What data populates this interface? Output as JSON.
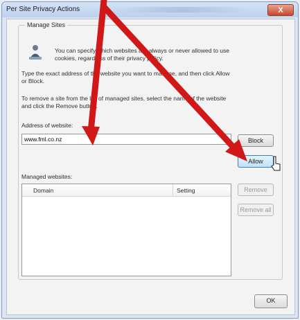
{
  "window": {
    "title": "Per Site Privacy Actions",
    "close_label": "X"
  },
  "group": {
    "label": "Manage Sites"
  },
  "info": {
    "line1": "You can specify which websites are always or never allowed to use",
    "line2": "cookies, regardless of their privacy policy."
  },
  "instructions": {
    "type_line1": "Type the exact address of the website you want to manage, and then click Allow",
    "type_line2": "or Block.",
    "remove_line1": "To remove a site from the list of managed sites, select the name of the website",
    "remove_line2": "and click the Remove button."
  },
  "address": {
    "label": "Address of website:",
    "value": "www.fml.co.nz"
  },
  "buttons": {
    "block": "Block",
    "allow": "Allow",
    "remove": "Remove",
    "remove_all": "Remove all",
    "ok": "OK"
  },
  "managed": {
    "label": "Managed websites:",
    "columns": [
      "Domain",
      "Setting"
    ],
    "rows": []
  },
  "annotation": {
    "arrow_color": "#d01818"
  },
  "colors": {
    "accent": "#3c7fb1",
    "close": "#c9462f"
  }
}
